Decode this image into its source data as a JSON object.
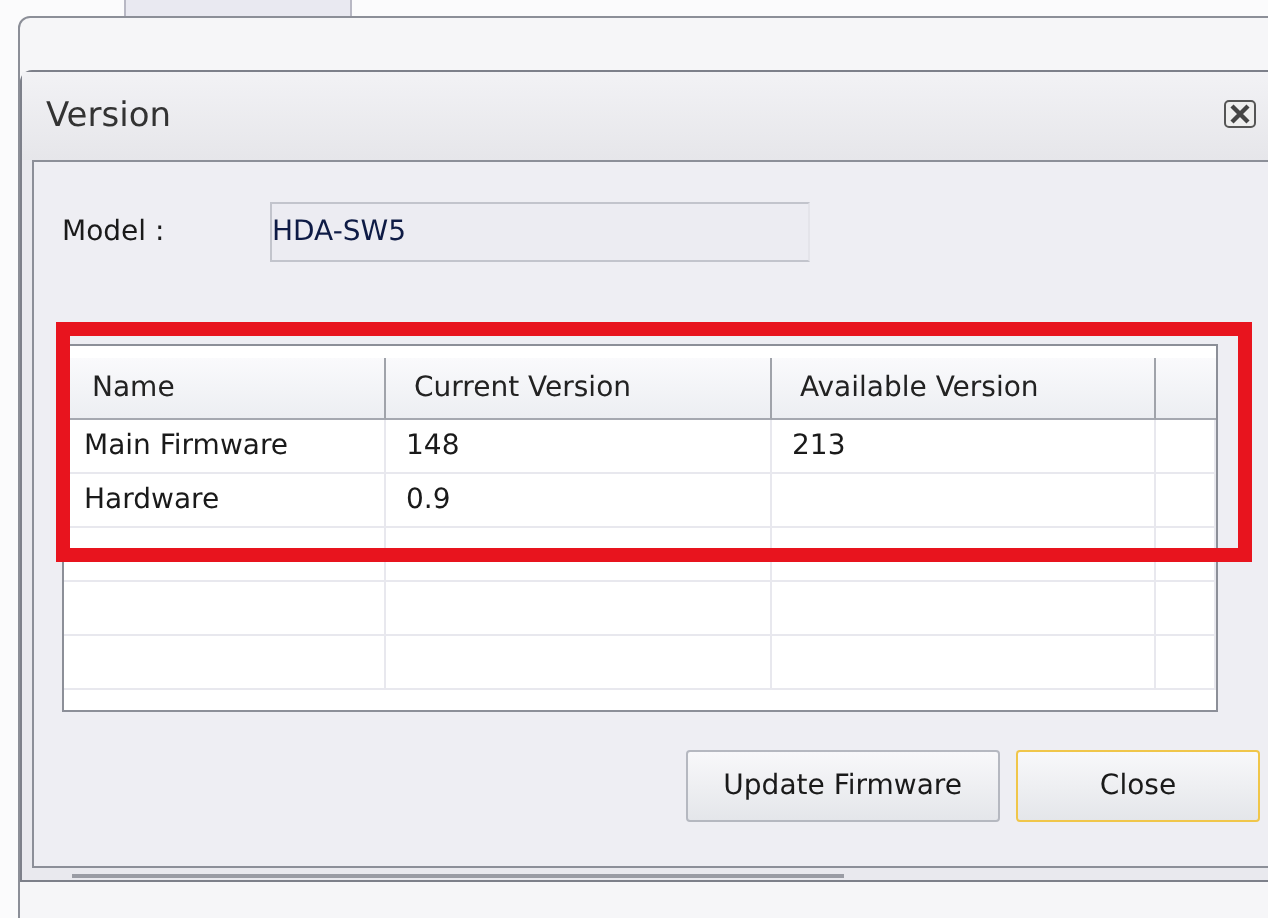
{
  "dialog": {
    "title": "Version",
    "model_label": "Model :",
    "model_value": "HDA-SW5",
    "table": {
      "columns": [
        "Name",
        "Current Version",
        "Available Version"
      ],
      "rows": [
        {
          "cells": [
            "Main Firmware",
            "148",
            "213"
          ]
        },
        {
          "cells": [
            "Hardware",
            "0.9",
            ""
          ]
        }
      ]
    },
    "highlight": {
      "color": "#e8141e"
    },
    "buttons": [
      {
        "label": "Update Firmware",
        "default": false
      },
      {
        "label": "Close",
        "default": true
      }
    ]
  }
}
